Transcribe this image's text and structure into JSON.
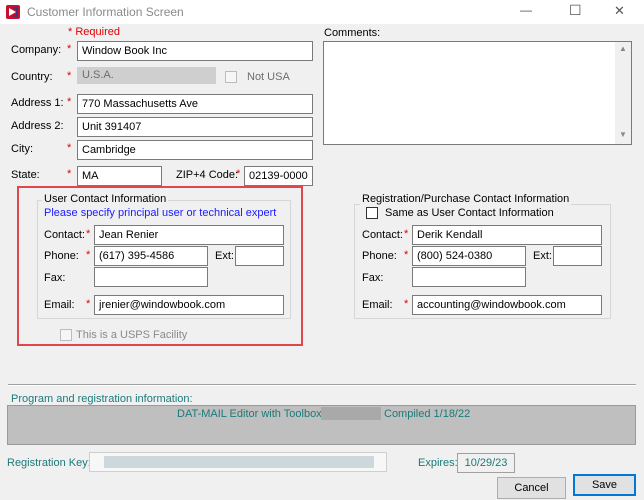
{
  "window": {
    "title": "Customer Information Screen",
    "minimize_glyph": "—",
    "maximize_glyph": "☐",
    "close_glyph": "✕"
  },
  "required_note": "* Required",
  "fields": {
    "company": {
      "label": "Company:",
      "value": "Window Book Inc"
    },
    "country": {
      "label": "Country:",
      "value": "U.S.A."
    },
    "not_usa": "Not USA",
    "address1": {
      "label": "Address 1:",
      "value": "770 Massachusetts Ave"
    },
    "address2": {
      "label": "Address 2:",
      "value": "Unit 391407"
    },
    "city": {
      "label": "City:",
      "value": "Cambridge"
    },
    "state": {
      "label": "State:",
      "value": "MA"
    },
    "zip": {
      "label": "ZIP+4 Code:",
      "value": "02139-0000"
    },
    "comments": {
      "label": "Comments:",
      "value": ""
    }
  },
  "user_contact": {
    "title": "User Contact Information",
    "note": "Please specify principal user or technical expert",
    "contact": {
      "label": "Contact:",
      "value": "Jean Renier"
    },
    "phone": {
      "label": "Phone:",
      "value": "(617) 395-4586"
    },
    "ext": {
      "label": "Ext:",
      "value": ""
    },
    "fax": {
      "label": "Fax:",
      "value": ""
    },
    "email": {
      "label": "Email:",
      "value": "jrenier@windowbook.com"
    },
    "usps_facility": "This is a USPS Facility"
  },
  "reg_contact": {
    "title": "Registration/Purchase Contact Information",
    "same_as": "Same as User Contact Information",
    "contact": {
      "label": "Contact:",
      "value": "Derik Kendall"
    },
    "phone": {
      "label": "Phone:",
      "value": "(800) 524-0380"
    },
    "ext": {
      "label": "Ext:",
      "value": ""
    },
    "fax": {
      "label": "Fax:",
      "value": ""
    },
    "email": {
      "label": "Email:",
      "value": "accounting@windowbook.com"
    }
  },
  "program": {
    "label": "Program and registration information:",
    "product": "DAT-MAIL Editor with Toolbox",
    "compiled": "Compiled 1/18/22"
  },
  "registration": {
    "key_label": "Registration Key:",
    "expires_label": "Expires:",
    "expires_value": "10/29/23"
  },
  "buttons": {
    "cancel": "Cancel",
    "save": "Save"
  },
  "colors": {
    "highlight_box": "#e0474c",
    "note_blue": "#1a1aff",
    "teal": "#1b7a7a",
    "required_red": "#e00000",
    "default_button_border": "#0078d7"
  }
}
